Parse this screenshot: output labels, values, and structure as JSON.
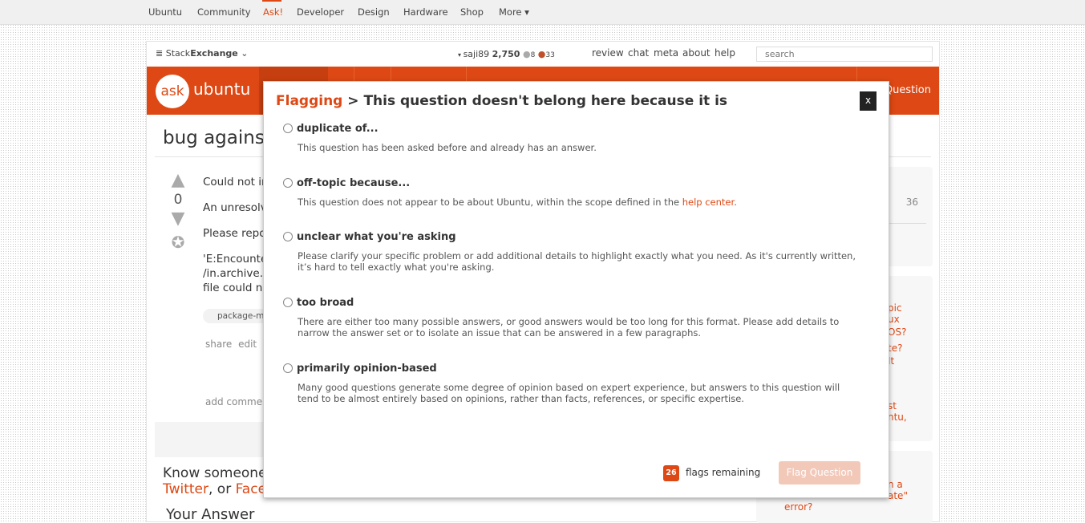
{
  "topnav": {
    "items": [
      "Ubuntu",
      "Community",
      "Ask!",
      "Developer",
      "Design",
      "Hardware",
      "Shop",
      "More ▾"
    ],
    "active": "Ask!"
  },
  "sebar": {
    "brand_prefix": "Stack",
    "brand_bold": "Exchange",
    "username": "saji89",
    "reputation": "2,750",
    "silver": "8",
    "bronze": "33",
    "links": [
      "review",
      "chat",
      "meta",
      "about",
      "help"
    ],
    "search_placeholder": "search"
  },
  "site": {
    "logo_ask": "ask",
    "logo_ubuntu": "ubuntu",
    "ask_question": "Question"
  },
  "question": {
    "title": "bug against",
    "votes": "0",
    "lines": [
      "Could not in",
      "An unresolva",
      "Please repo",
      "'E:Encounte",
      "/in.archive.u",
      "file could no"
    ],
    "tag": "package-ma",
    "actions": "share edit fl",
    "add_comment": "add comment",
    "know": "Know someone",
    "twitter": "Twitter",
    "or": ", or ",
    "face": "Face",
    "your_answer": "Your Answer"
  },
  "sidebar": {
    "stat": "36",
    "related": [
      "pic",
      "ux OS?",
      "te? It",
      "st",
      "ntu,",
      "n a",
      "ate\"",
      "error?"
    ]
  },
  "dialog": {
    "title_link": "Flagging",
    "title_rest": " > This question doesn't belong here because it is",
    "close": "x",
    "options": [
      {
        "label": "duplicate of...",
        "desc": "This question has been asked before and already has an answer."
      },
      {
        "label": "off-topic because...",
        "desc": "This question does not appear to be about Ubuntu, within the scope defined in the ",
        "desc_link": "help center",
        "desc_end": "."
      },
      {
        "label": "unclear what you're asking",
        "desc": "Please clarify your specific problem or add additional details to highlight exactly what you need. As it's currently written, it’s hard to tell exactly what you're asking."
      },
      {
        "label": "too broad",
        "desc": "There are either too many possible answers, or good answers would be too long for this format. Please add details to narrow the answer set or to isolate an issue that can be answered in a few paragraphs."
      },
      {
        "label": "primarily opinion-based",
        "desc": "Many good questions generate some degree of opinion based on expert experience, but answers to this question will tend to be almost entirely based on opinions, rather than facts, references, or specific expertise."
      }
    ],
    "flags_count": "26",
    "flags_remaining": "flags remaining",
    "submit": "Flag Question"
  },
  "colors": {
    "accent": "#dd4814",
    "disabled_button": "#f2c8b9"
  }
}
